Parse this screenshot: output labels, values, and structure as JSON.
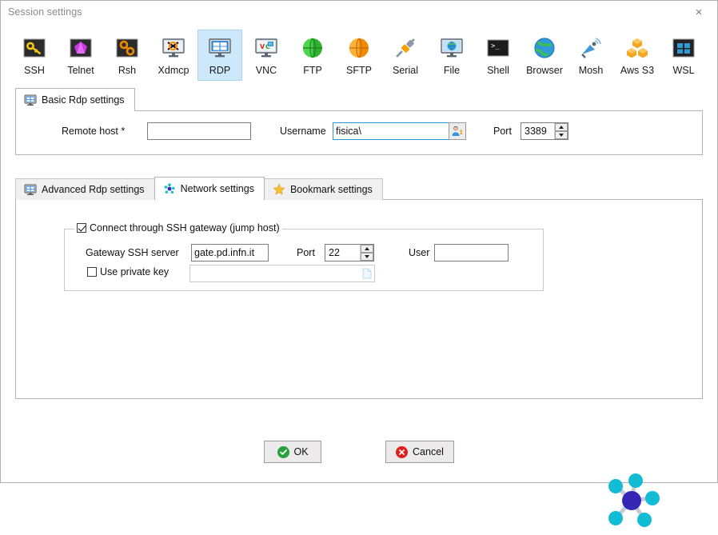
{
  "window": {
    "title": "Session settings",
    "close_label": "×"
  },
  "protocols": [
    {
      "label": "SSH",
      "icon": "ssh-key-icon",
      "selected": false
    },
    {
      "label": "Telnet",
      "icon": "telnet-icon",
      "selected": false
    },
    {
      "label": "Rsh",
      "icon": "rsh-icon",
      "selected": false
    },
    {
      "label": "Xdmcp",
      "icon": "xdmcp-icon",
      "selected": false
    },
    {
      "label": "RDP",
      "icon": "rdp-icon",
      "selected": true
    },
    {
      "label": "VNC",
      "icon": "vnc-icon",
      "selected": false
    },
    {
      "label": "FTP",
      "icon": "ftp-globe-icon",
      "selected": false
    },
    {
      "label": "SFTP",
      "icon": "sftp-globe-icon",
      "selected": false
    },
    {
      "label": "Serial",
      "icon": "serial-plug-icon",
      "selected": false
    },
    {
      "label": "File",
      "icon": "file-share-icon",
      "selected": false
    },
    {
      "label": "Shell",
      "icon": "shell-terminal-icon",
      "selected": false
    },
    {
      "label": "Browser",
      "icon": "browser-globe-icon",
      "selected": false
    },
    {
      "label": "Mosh",
      "icon": "mosh-satellite-icon",
      "selected": false
    },
    {
      "label": "Aws S3",
      "icon": "aws-s3-icon",
      "selected": false
    },
    {
      "label": "WSL",
      "icon": "wsl-windows-icon",
      "selected": false
    }
  ],
  "basic": {
    "tab_label": "Basic Rdp settings",
    "tab_icon": "monitor-icon",
    "remote_host_label": "Remote host *",
    "remote_host_value": "",
    "remote_host_placeholder": "",
    "username_label": "Username",
    "username_value": "fisica\\",
    "username_placeholder": "",
    "user_picker_icon": "user-picker-icon",
    "port_label": "Port",
    "port_value": "3389"
  },
  "tabs": [
    {
      "label": "Advanced Rdp settings",
      "icon": "monitor-icon",
      "active": false
    },
    {
      "label": "Network settings",
      "icon": "network-nodes-icon",
      "active": true
    },
    {
      "label": "Bookmark settings",
      "icon": "star-icon",
      "active": false
    }
  ],
  "network": {
    "gateway_group_label": "Connect through SSH gateway (jump host)",
    "gateway_group_checked": true,
    "server_label": "Gateway SSH server",
    "server_value": "gate.pd.infn.it",
    "port_label": "Port",
    "port_value": "22",
    "user_label": "User",
    "user_value": "",
    "private_key_label": "Use private key",
    "private_key_checked": false,
    "private_key_value": "",
    "private_key_browse_icon": "document-icon",
    "decoration_icon": "network-hub-icon"
  },
  "footer": {
    "ok_label": "OK",
    "ok_icon": "check-circle-icon",
    "cancel_label": "Cancel",
    "cancel_icon": "cross-circle-icon"
  },
  "colors": {
    "selection_blue": "#cde8fa",
    "focus_border": "#2f95d6",
    "ok_green": "#28a03c",
    "cancel_red": "#e02020",
    "hub_node_cyan": "#12bcd4",
    "hub_center_blue": "#3526b5"
  }
}
